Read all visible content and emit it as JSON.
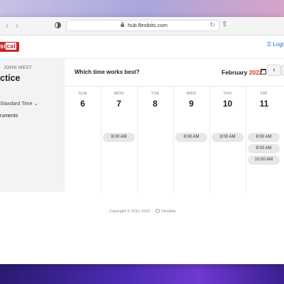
{
  "browser": {
    "url": "hub.flexibits.com"
  },
  "header": {
    "logo_prefix": "si",
    "logo_cal": "cal",
    "login_label": "Logi"
  },
  "left_panel": {
    "host_name": "JOHN WEST",
    "event_title": "ctice",
    "timezone": "Standard Time",
    "item": "ruments"
  },
  "calendar": {
    "question": "Which time works best?",
    "month": "February",
    "year": "2022",
    "days": [
      {
        "dow": "SUN",
        "date": "6",
        "slots": []
      },
      {
        "dow": "MON",
        "date": "7",
        "slots": [
          "8:00 AM"
        ]
      },
      {
        "dow": "TUE",
        "date": "8",
        "slots": []
      },
      {
        "dow": "WED",
        "date": "9",
        "slots": [
          "8:00 AM"
        ]
      },
      {
        "dow": "THU",
        "date": "10",
        "slots": [
          "8:00 AM"
        ]
      },
      {
        "dow": "FRI",
        "date": "11",
        "slots": [
          "8:00 AM",
          "9:00 AM",
          "10:00 AM"
        ]
      }
    ]
  },
  "footer": {
    "copyright": "Copyright © 2011–2022",
    "brand": "Flexibits"
  },
  "colors": {
    "accent_red": "#d0312d",
    "link_blue": "#1e6fd9"
  }
}
